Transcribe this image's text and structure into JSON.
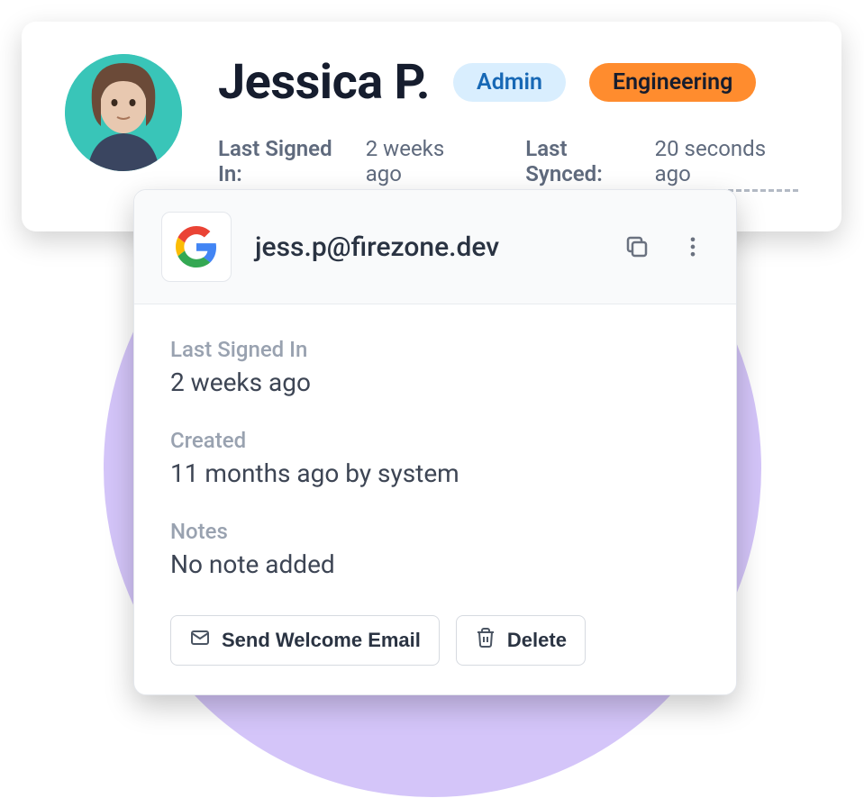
{
  "profile": {
    "name": "Jessica P.",
    "badges": {
      "admin": "Admin",
      "eng": "Engineering"
    },
    "meta": {
      "last_signed_label": "Last Signed In:",
      "last_signed_value": "2 weeks ago",
      "last_synced_label": "Last Synced:",
      "last_synced_value": "20 seconds ago"
    }
  },
  "detail": {
    "email": "jess.p@firezone.dev",
    "fields": {
      "last_signed": {
        "label": "Last Signed In",
        "value": "2 weeks ago"
      },
      "created": {
        "label": "Created",
        "value": "11 months ago by system"
      },
      "notes": {
        "label": "Notes",
        "value": "No note added"
      }
    },
    "actions": {
      "welcome": "Send Welcome Email",
      "delete": "Delete"
    }
  }
}
